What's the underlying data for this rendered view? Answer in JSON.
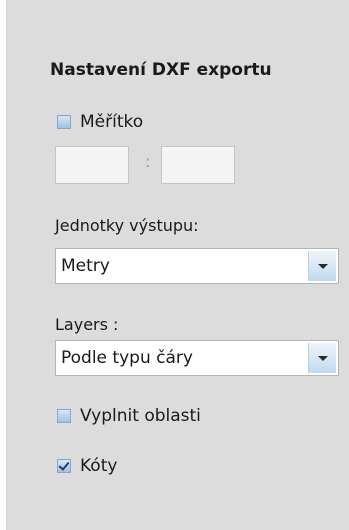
{
  "title": "Nastavení DXF exportu",
  "scale": {
    "label": "Měřítko",
    "checked": false,
    "left_value": "",
    "right_value": "",
    "separator": ":"
  },
  "output_units": {
    "label": "Jednotky výstupu:",
    "selected": "Metry"
  },
  "layers": {
    "label": "Layers :",
    "selected": "Podle typu čáry"
  },
  "fill_areas": {
    "label": "Vyplnit oblasti",
    "checked": false
  },
  "dimensions": {
    "label": "Kóty",
    "checked": true
  },
  "colors": {
    "panel_background": "#dcdcdc",
    "checkbox_accent": "#9fc0e6"
  }
}
